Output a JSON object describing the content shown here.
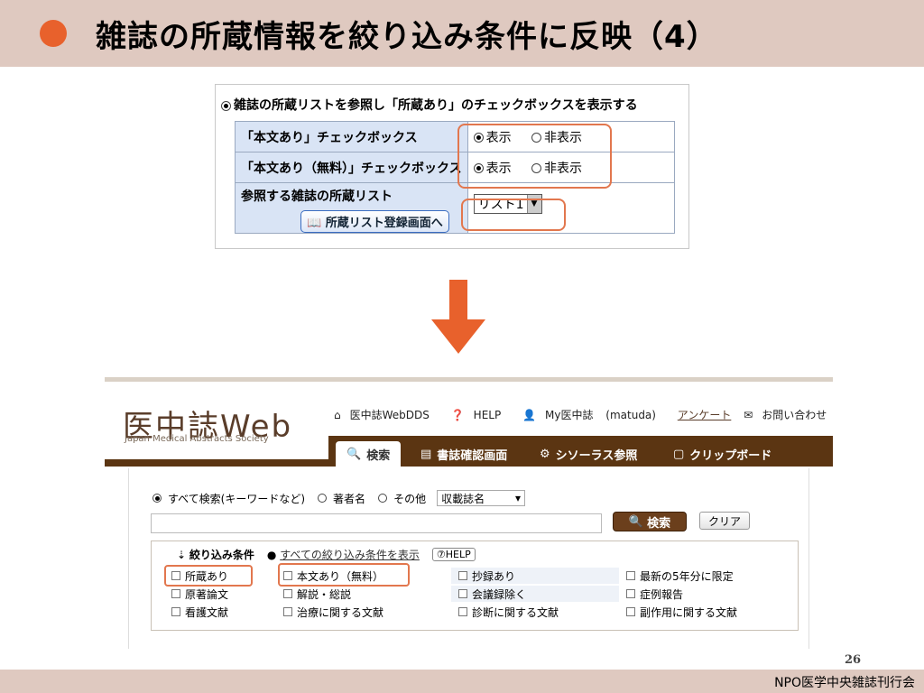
{
  "slide": {
    "title": "雑誌の所蔵情報を絞り込み条件に反映（4）",
    "page_number": "26",
    "footer": "NPO医学中央雑誌刊行会",
    "accent_color": "#e8612c"
  },
  "panel1": {
    "top_option": "雑誌の所蔵リストを参照し「所蔵あり」のチェックボックスを表示する",
    "rows": [
      {
        "label": "「本文あり」チェックボックス",
        "show": "表示",
        "hide": "非表示"
      },
      {
        "label": "「本文あり（無料）」チェックボックス",
        "show": "表示",
        "hide": "非表示"
      }
    ],
    "list_label": "参照する雑誌の所蔵リスト",
    "list_button": "所蔵リスト登録画面へ",
    "list_select": "リスト1"
  },
  "panel2": {
    "logo": "医中誌Web",
    "logo_sub": "Japan Medical Abstracts Society",
    "topnav": {
      "dds": "医中誌WebDDS",
      "help": "HELP",
      "my": "My医中誌",
      "user": "(matuda)",
      "survey": "アンケート",
      "contact": "お問い合わせ"
    },
    "tabs": [
      "検索",
      "書誌確認画面",
      "シソーラス参照",
      "クリップボード"
    ],
    "mode": {
      "all": "すべて検索(キーワードなど)",
      "author": "著者名",
      "other": "その他",
      "select": "収載誌名"
    },
    "search_button": "検索",
    "clear_button": "クリア",
    "filter": {
      "title": "絞り込み条件",
      "all_link": "すべての絞り込み条件を表示",
      "help": "HELP",
      "rows": [
        [
          "所蔵あり",
          "本文あり（無料）",
          "抄録あり",
          "最新の5年分に限定"
        ],
        [
          "原著論文",
          "解説・総説",
          "会議録除く",
          "症例報告"
        ],
        [
          "看護文献",
          "治療に関する文献",
          "診断に関する文献",
          "副作用に関する文献"
        ]
      ]
    }
  }
}
